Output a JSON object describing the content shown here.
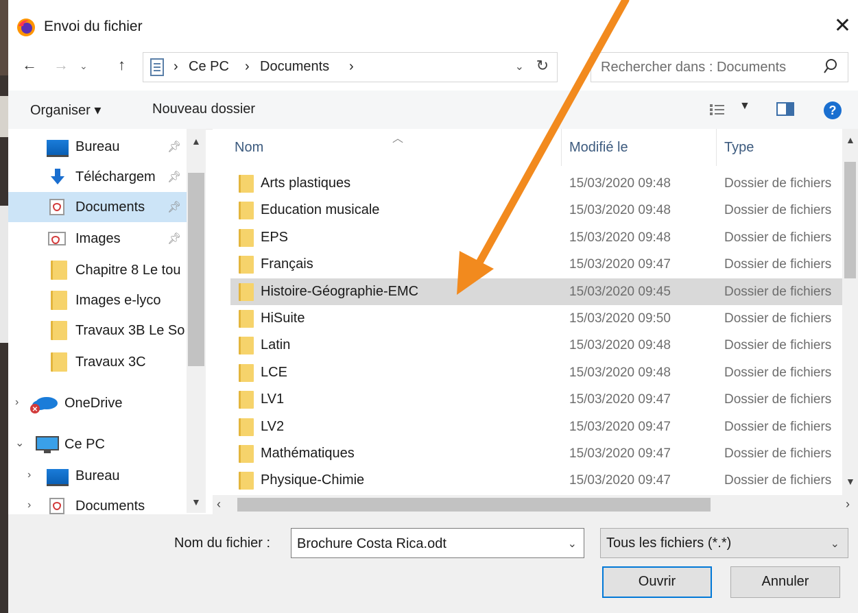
{
  "window": {
    "title": "Envoi du fichier",
    "close_glyph": "✕"
  },
  "address": {
    "breadcrumbs": [
      "Ce PC",
      "Documents"
    ],
    "separator": "›",
    "search_placeholder": "Rechercher dans : Documents"
  },
  "toolbar": {
    "organize_label": "Organiser ▾",
    "new_folder_label": "Nouveau dossier"
  },
  "nav": {
    "quick_access": [
      {
        "label": "Bureau",
        "icon": "desktop-icon",
        "pinned": true
      },
      {
        "label": "Téléchargem",
        "icon": "download-icon",
        "pinned": true
      },
      {
        "label": "Documents",
        "icon": "documents-icon",
        "pinned": true,
        "selected": true
      },
      {
        "label": "Images",
        "icon": "images-icon",
        "pinned": true
      },
      {
        "label": "Chapitre 8 Le tou",
        "icon": "folder-icon"
      },
      {
        "label": "Images e-lyco",
        "icon": "folder-icon"
      },
      {
        "label": "Travaux 3B Le So",
        "icon": "folder-icon"
      },
      {
        "label": "Travaux 3C",
        "icon": "folder-icon"
      }
    ],
    "onedrive_label": "OneDrive",
    "this_pc_label": "Ce PC",
    "this_pc_children": [
      {
        "label": "Bureau",
        "icon": "desktop-icon"
      },
      {
        "label": "Documents",
        "icon": "documents-icon"
      }
    ]
  },
  "list": {
    "columns": [
      "Nom",
      "Modifié le",
      "Type"
    ],
    "rows": [
      {
        "name": "Arts plastiques",
        "modified": "15/03/2020 09:48",
        "type": "Dossier de fichiers"
      },
      {
        "name": "Education musicale",
        "modified": "15/03/2020 09:48",
        "type": "Dossier de fichiers"
      },
      {
        "name": "EPS",
        "modified": "15/03/2020 09:48",
        "type": "Dossier de fichiers"
      },
      {
        "name": "Français",
        "modified": "15/03/2020 09:47",
        "type": "Dossier de fichiers"
      },
      {
        "name": "Histoire-Géographie-EMC",
        "modified": "15/03/2020 09:45",
        "type": "Dossier de fichiers",
        "selected": true
      },
      {
        "name": "HiSuite",
        "modified": "15/03/2020 09:50",
        "type": "Dossier de fichiers"
      },
      {
        "name": "Latin",
        "modified": "15/03/2020 09:48",
        "type": "Dossier de fichiers"
      },
      {
        "name": "LCE",
        "modified": "15/03/2020 09:48",
        "type": "Dossier de fichiers"
      },
      {
        "name": "LV1",
        "modified": "15/03/2020 09:47",
        "type": "Dossier de fichiers"
      },
      {
        "name": "LV2",
        "modified": "15/03/2020 09:47",
        "type": "Dossier de fichiers"
      },
      {
        "name": "Mathématiques",
        "modified": "15/03/2020 09:47",
        "type": "Dossier de fichiers"
      },
      {
        "name": "Physique-Chimie",
        "modified": "15/03/2020 09:47",
        "type": "Dossier de fichiers"
      }
    ]
  },
  "footer": {
    "filename_label": "Nom du fichier :",
    "filename_value": "Brochure Costa Rica.odt",
    "filetype_value": "Tous les fichiers (*.*)",
    "open_label": "Ouvrir",
    "cancel_label": "Annuler"
  },
  "colors": {
    "accent": "#0078d7",
    "selection_nav": "#cce4f7",
    "selection_row": "#d9d9d9",
    "annotation_arrow": "#f28a1e"
  }
}
